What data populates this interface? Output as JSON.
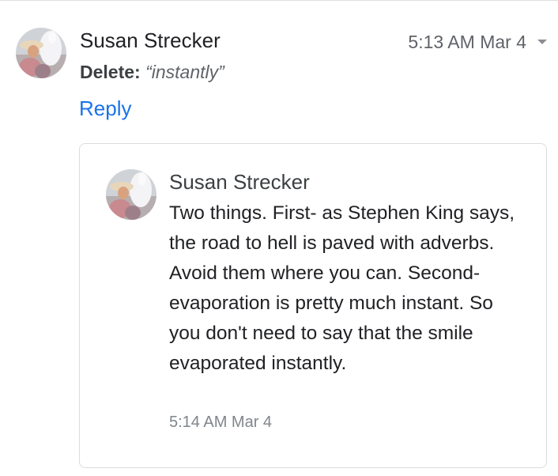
{
  "comment": {
    "author": "Susan Strecker",
    "timestamp": "5:13 AM Mar 4",
    "suggestion_label": "Delete:",
    "suggestion_text": "“instantly”",
    "reply_label": "Reply",
    "menu_icon": "chevron-down-icon"
  },
  "reply": {
    "author": "Susan Strecker",
    "body": "Two things. First- as Stephen King says, the road to hell is paved with adverbs. Avoid them where you can. Second- evaporation is pretty much instant. So you don't need to say that the smile evaporated instantly.",
    "timestamp": "5:14 AM Mar 4"
  }
}
